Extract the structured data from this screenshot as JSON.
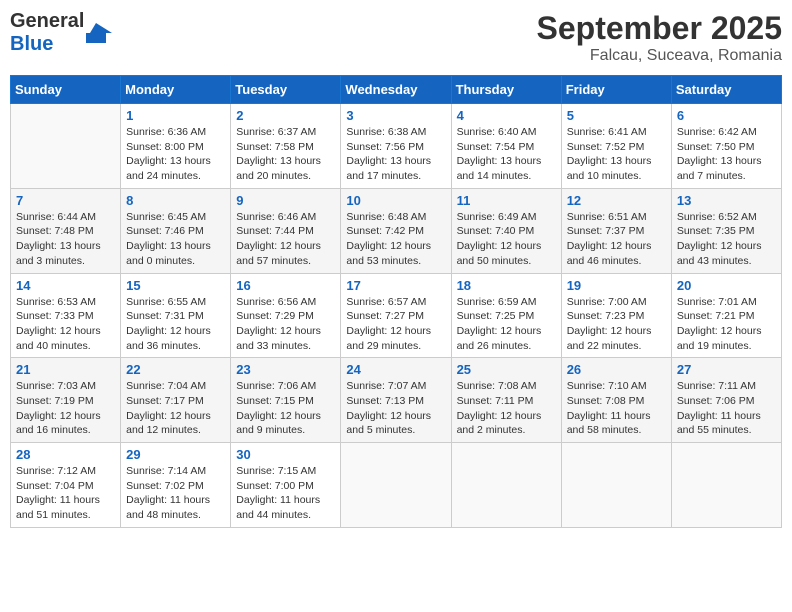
{
  "logo": {
    "line1": "General",
    "line2": "Blue"
  },
  "title": "September 2025",
  "location": "Falcau, Suceava, Romania",
  "weekdays": [
    "Sunday",
    "Monday",
    "Tuesday",
    "Wednesday",
    "Thursday",
    "Friday",
    "Saturday"
  ],
  "weeks": [
    [
      {
        "day": "",
        "info": ""
      },
      {
        "day": "1",
        "info": "Sunrise: 6:36 AM\nSunset: 8:00 PM\nDaylight: 13 hours\nand 24 minutes."
      },
      {
        "day": "2",
        "info": "Sunrise: 6:37 AM\nSunset: 7:58 PM\nDaylight: 13 hours\nand 20 minutes."
      },
      {
        "day": "3",
        "info": "Sunrise: 6:38 AM\nSunset: 7:56 PM\nDaylight: 13 hours\nand 17 minutes."
      },
      {
        "day": "4",
        "info": "Sunrise: 6:40 AM\nSunset: 7:54 PM\nDaylight: 13 hours\nand 14 minutes."
      },
      {
        "day": "5",
        "info": "Sunrise: 6:41 AM\nSunset: 7:52 PM\nDaylight: 13 hours\nand 10 minutes."
      },
      {
        "day": "6",
        "info": "Sunrise: 6:42 AM\nSunset: 7:50 PM\nDaylight: 13 hours\nand 7 minutes."
      }
    ],
    [
      {
        "day": "7",
        "info": "Sunrise: 6:44 AM\nSunset: 7:48 PM\nDaylight: 13 hours\nand 3 minutes."
      },
      {
        "day": "8",
        "info": "Sunrise: 6:45 AM\nSunset: 7:46 PM\nDaylight: 13 hours\nand 0 minutes."
      },
      {
        "day": "9",
        "info": "Sunrise: 6:46 AM\nSunset: 7:44 PM\nDaylight: 12 hours\nand 57 minutes."
      },
      {
        "day": "10",
        "info": "Sunrise: 6:48 AM\nSunset: 7:42 PM\nDaylight: 12 hours\nand 53 minutes."
      },
      {
        "day": "11",
        "info": "Sunrise: 6:49 AM\nSunset: 7:40 PM\nDaylight: 12 hours\nand 50 minutes."
      },
      {
        "day": "12",
        "info": "Sunrise: 6:51 AM\nSunset: 7:37 PM\nDaylight: 12 hours\nand 46 minutes."
      },
      {
        "day": "13",
        "info": "Sunrise: 6:52 AM\nSunset: 7:35 PM\nDaylight: 12 hours\nand 43 minutes."
      }
    ],
    [
      {
        "day": "14",
        "info": "Sunrise: 6:53 AM\nSunset: 7:33 PM\nDaylight: 12 hours\nand 40 minutes."
      },
      {
        "day": "15",
        "info": "Sunrise: 6:55 AM\nSunset: 7:31 PM\nDaylight: 12 hours\nand 36 minutes."
      },
      {
        "day": "16",
        "info": "Sunrise: 6:56 AM\nSunset: 7:29 PM\nDaylight: 12 hours\nand 33 minutes."
      },
      {
        "day": "17",
        "info": "Sunrise: 6:57 AM\nSunset: 7:27 PM\nDaylight: 12 hours\nand 29 minutes."
      },
      {
        "day": "18",
        "info": "Sunrise: 6:59 AM\nSunset: 7:25 PM\nDaylight: 12 hours\nand 26 minutes."
      },
      {
        "day": "19",
        "info": "Sunrise: 7:00 AM\nSunset: 7:23 PM\nDaylight: 12 hours\nand 22 minutes."
      },
      {
        "day": "20",
        "info": "Sunrise: 7:01 AM\nSunset: 7:21 PM\nDaylight: 12 hours\nand 19 minutes."
      }
    ],
    [
      {
        "day": "21",
        "info": "Sunrise: 7:03 AM\nSunset: 7:19 PM\nDaylight: 12 hours\nand 16 minutes."
      },
      {
        "day": "22",
        "info": "Sunrise: 7:04 AM\nSunset: 7:17 PM\nDaylight: 12 hours\nand 12 minutes."
      },
      {
        "day": "23",
        "info": "Sunrise: 7:06 AM\nSunset: 7:15 PM\nDaylight: 12 hours\nand 9 minutes."
      },
      {
        "day": "24",
        "info": "Sunrise: 7:07 AM\nSunset: 7:13 PM\nDaylight: 12 hours\nand 5 minutes."
      },
      {
        "day": "25",
        "info": "Sunrise: 7:08 AM\nSunset: 7:11 PM\nDaylight: 12 hours\nand 2 minutes."
      },
      {
        "day": "26",
        "info": "Sunrise: 7:10 AM\nSunset: 7:08 PM\nDaylight: 11 hours\nand 58 minutes."
      },
      {
        "day": "27",
        "info": "Sunrise: 7:11 AM\nSunset: 7:06 PM\nDaylight: 11 hours\nand 55 minutes."
      }
    ],
    [
      {
        "day": "28",
        "info": "Sunrise: 7:12 AM\nSunset: 7:04 PM\nDaylight: 11 hours\nand 51 minutes."
      },
      {
        "day": "29",
        "info": "Sunrise: 7:14 AM\nSunset: 7:02 PM\nDaylight: 11 hours\nand 48 minutes."
      },
      {
        "day": "30",
        "info": "Sunrise: 7:15 AM\nSunset: 7:00 PM\nDaylight: 11 hours\nand 44 minutes."
      },
      {
        "day": "",
        "info": ""
      },
      {
        "day": "",
        "info": ""
      },
      {
        "day": "",
        "info": ""
      },
      {
        "day": "",
        "info": ""
      }
    ]
  ]
}
